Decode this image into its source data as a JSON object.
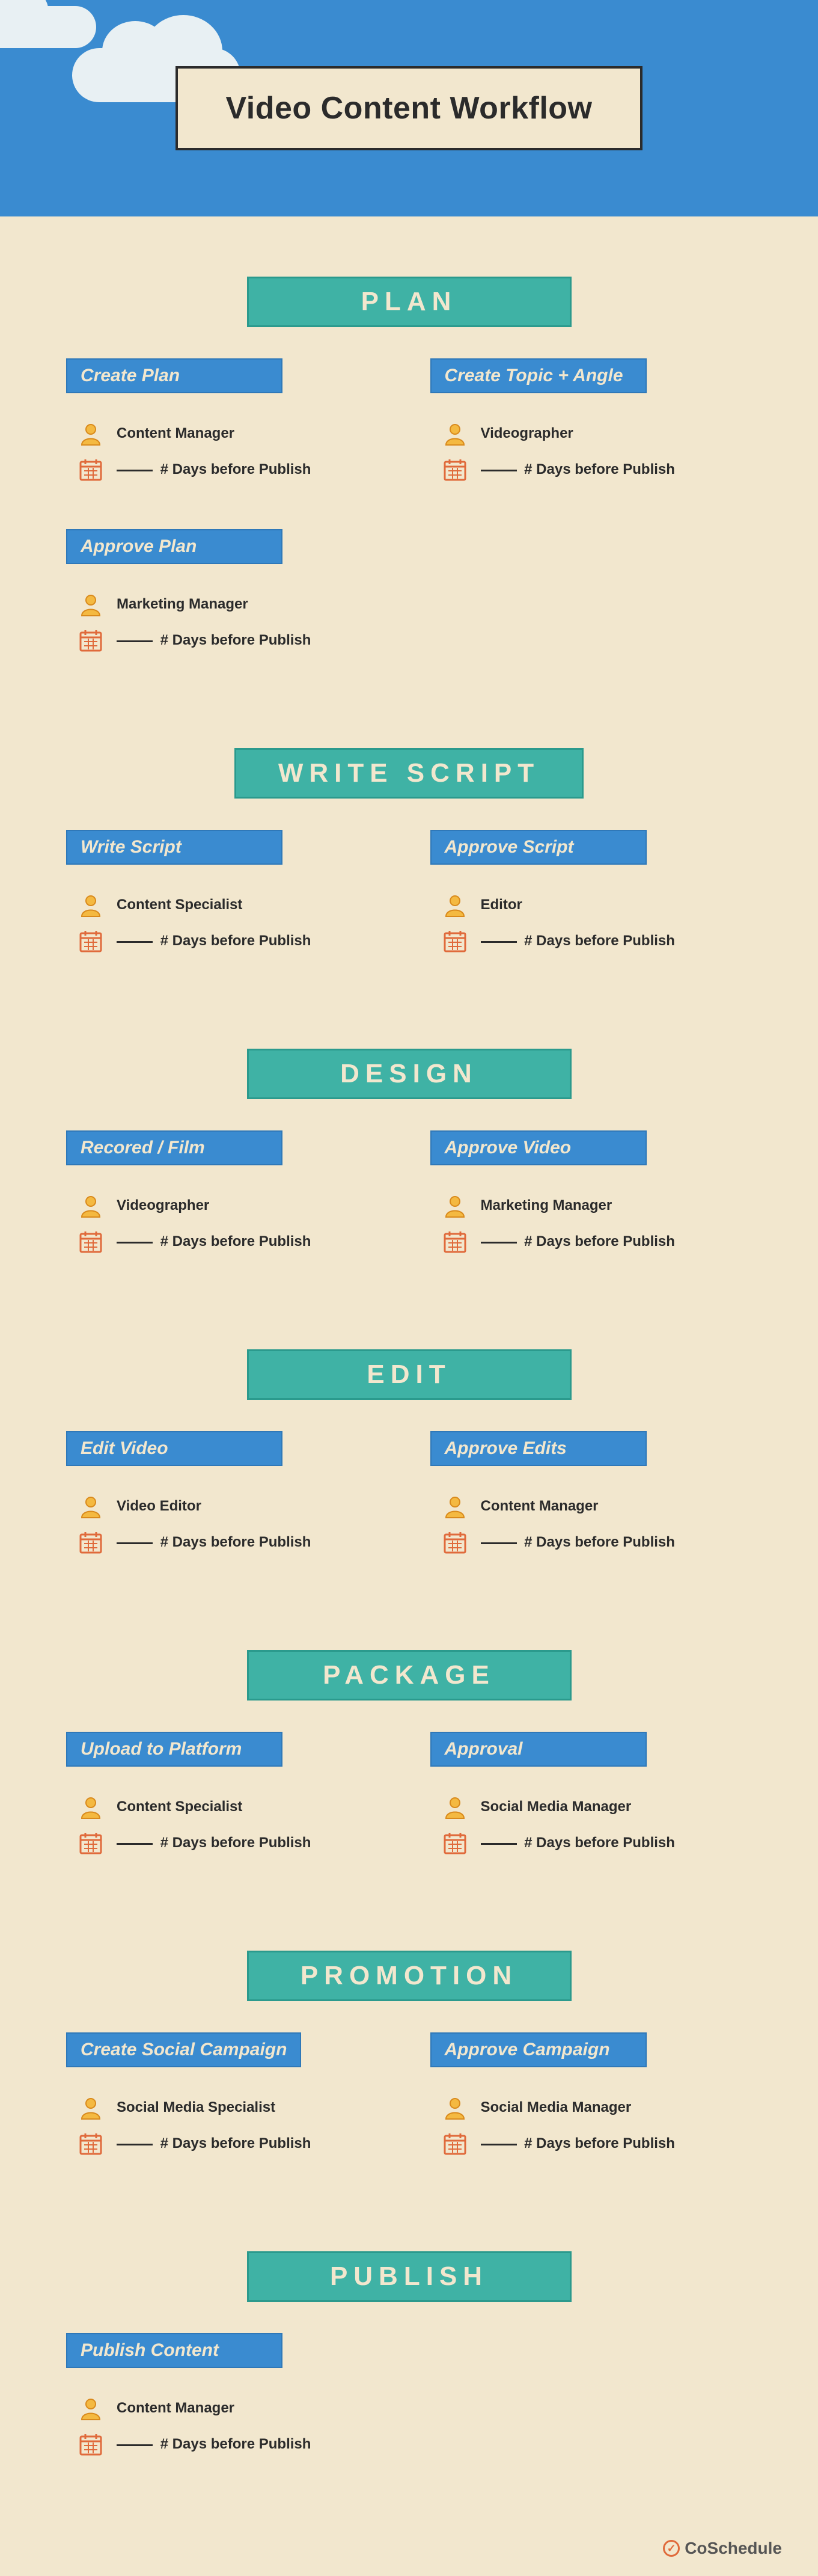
{
  "title": "Video Content Workflow",
  "days_suffix": "# Days before Publish",
  "sections": [
    {
      "name": "PLAN",
      "cards": [
        {
          "label": "Create Plan",
          "role": "Content Manager"
        },
        {
          "label": "Create Topic + Angle",
          "role": "Videographer"
        },
        {
          "label": "Approve Plan",
          "role": "Marketing Manager"
        }
      ]
    },
    {
      "name": "WRITE SCRIPT",
      "cards": [
        {
          "label": "Write Script",
          "role": "Content Specialist"
        },
        {
          "label": "Approve Script",
          "role": "Editor"
        }
      ]
    },
    {
      "name": "DESIGN",
      "cards": [
        {
          "label": "Recored / Film",
          "role": "Videographer"
        },
        {
          "label": "Approve Video",
          "role": "Marketing Manager"
        }
      ]
    },
    {
      "name": "EDIT",
      "cards": [
        {
          "label": "Edit Video",
          "role": "Video Editor"
        },
        {
          "label": "Approve Edits",
          "role": "Content Manager"
        }
      ]
    },
    {
      "name": "PACKAGE",
      "cards": [
        {
          "label": "Upload to Platform",
          "role": "Content Specialist"
        },
        {
          "label": "Approval",
          "role": "Social Media Manager"
        }
      ]
    },
    {
      "name": "PROMOTION",
      "cards": [
        {
          "label": "Create Social Campaign",
          "role": "Social Media Specialist"
        },
        {
          "label": "Approve Campaign",
          "role": "Social Media Manager"
        }
      ]
    },
    {
      "name": "PUBLISH",
      "cards": [
        {
          "label": "Publish Content",
          "role": "Content Manager"
        }
      ]
    }
  ],
  "footer_brand": "CoSchedule"
}
